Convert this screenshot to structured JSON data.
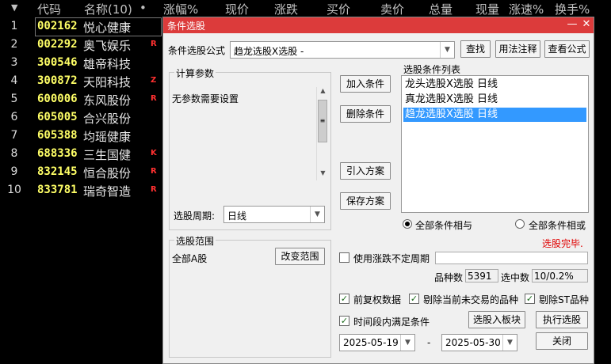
{
  "table": {
    "columns": [
      "代码",
      "名称(10)",
      "•",
      "涨幅%",
      "现价",
      "涨跌",
      "买价",
      "卖价",
      "总量",
      "现量",
      "涨速%",
      "换手%"
    ],
    "rows": [
      {
        "idx": "1",
        "code": "002162",
        "name": "悦心健康",
        "flag": ""
      },
      {
        "idx": "2",
        "code": "002292",
        "name": "奥飞娱乐",
        "flag": "R"
      },
      {
        "idx": "3",
        "code": "300546",
        "name": "雄帝科技",
        "flag": ""
      },
      {
        "idx": "4",
        "code": "300872",
        "name": "天阳科技",
        "flag": "Z"
      },
      {
        "idx": "5",
        "code": "600006",
        "name": "东风股份",
        "flag": "R"
      },
      {
        "idx": "6",
        "code": "605005",
        "name": "合兴股份",
        "flag": ""
      },
      {
        "idx": "7",
        "code": "605388",
        "name": "均瑶健康",
        "flag": ""
      },
      {
        "idx": "8",
        "code": "688336",
        "name": "三生国健",
        "flag": "K"
      },
      {
        "idx": "9",
        "code": "832145",
        "name": "恒合股份",
        "flag": "R"
      },
      {
        "idx": "10",
        "code": "833781",
        "name": "瑞奇智造",
        "flag": "R"
      }
    ]
  },
  "dialog": {
    "title": "条件选股",
    "formula_label": "条件选股公式",
    "formula_value": "趋龙选股X选股 -",
    "btn_search": "查找",
    "btn_usage": "用法注释",
    "btn_view": "查看公式",
    "params_group": "计算参数",
    "params_text": "无参数需要设置",
    "btn_add": "加入条件",
    "btn_delete": "删除条件",
    "btn_import": "引入方案",
    "btn_save": "保存方案",
    "cond_list_label": "选股条件列表",
    "conditions": [
      {
        "text": "龙头选股X选股  日线",
        "active": false
      },
      {
        "text": "真龙选股X选股  日线",
        "active": false
      },
      {
        "text": "趋龙选股X选股  日线",
        "active": true
      }
    ],
    "period_label": "选股周期:",
    "period_value": "日线",
    "radio_and": "全部条件相与",
    "radio_or": "全部条件相或",
    "status": "选股完毕.",
    "range_group": "选股范围",
    "range_value": "全部A股",
    "btn_change_range": "改变范围",
    "use_uncertain_period": "使用涨跌不定周期",
    "count_label": "品种数",
    "count_value": "5391",
    "selected_label": "选中数",
    "selected_value": "10/0.2%",
    "chk_prerights": "前复权数据",
    "chk_exclude_untraded": "剔除当前未交易的品种",
    "chk_exclude_st": "剔除ST品种",
    "chk_time_range": "时间段内满足条件",
    "btn_to_block": "选股入板块",
    "btn_execute": "执行选股",
    "date_from": "2025-05-19",
    "date_sep": "-",
    "date_to": "2025-05-30",
    "btn_close": "关闭",
    "colors": {
      "title_bar": "#dc3b3b",
      "status": "#e00000",
      "selection": "#3399ff"
    }
  }
}
